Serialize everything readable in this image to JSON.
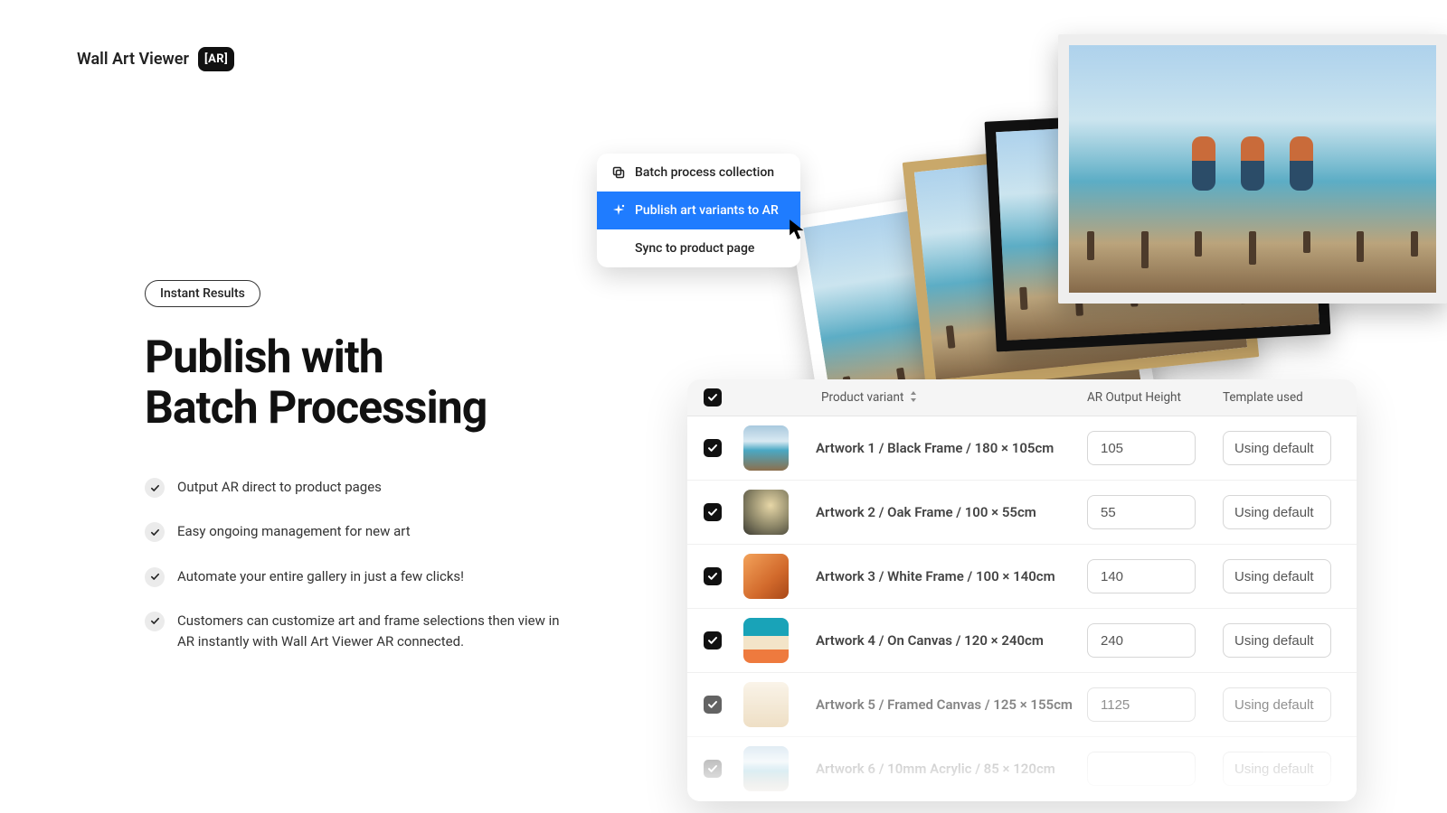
{
  "brand": {
    "name": "Wall Art Viewer",
    "badge": "[AR]"
  },
  "hero": {
    "pill": "Instant Results",
    "headline": "Publish with\nBatch Processing",
    "bullets": [
      "Output AR direct to product pages",
      "Easy ongoing management for new art",
      "Automate your entire gallery in just a few clicks!",
      "Customers can customize art and frame selections then view in AR instantly with Wall Art Viewer AR connected."
    ]
  },
  "context_menu": {
    "items": [
      {
        "label": "Batch process collection",
        "active": false,
        "icon": "stack-icon"
      },
      {
        "label": "Publish art variants to AR",
        "active": true,
        "icon": "sparkle-icon"
      },
      {
        "label": "Sync to product page",
        "active": false,
        "icon": null
      }
    ]
  },
  "table": {
    "columns": {
      "variant": "Product variant",
      "height": "AR Output Height",
      "template": "Template used"
    },
    "template_button_label": "Using default",
    "header_checked": true,
    "rows": [
      {
        "checked": true,
        "thumb": "g-pier",
        "name": "Artwork 1 / Black Frame / 180 × 105cm",
        "height": "105",
        "fade": ""
      },
      {
        "checked": true,
        "thumb": "g-storm",
        "name": "Artwork 2 / Oak Frame / 100 × 55cm",
        "height": "55",
        "fade": ""
      },
      {
        "checked": true,
        "thumb": "g-dune",
        "name": "Artwork 3 / White Frame / 100 × 140cm",
        "height": "140",
        "fade": ""
      },
      {
        "checked": true,
        "thumb": "g-beach",
        "name": "Artwork 4 / On Canvas / 120 × 240cm",
        "height": "240",
        "fade": ""
      },
      {
        "checked": true,
        "thumb": "g-palm",
        "name": "Artwork 5 / Framed Canvas / 125 × 155cm",
        "height": "1125",
        "fade": "fade1"
      },
      {
        "checked": true,
        "thumb": "g-pier",
        "name": "Artwork 6 / 10mm Acrylic / 85 × 120cm",
        "height": "",
        "fade": "fade2"
      }
    ]
  }
}
